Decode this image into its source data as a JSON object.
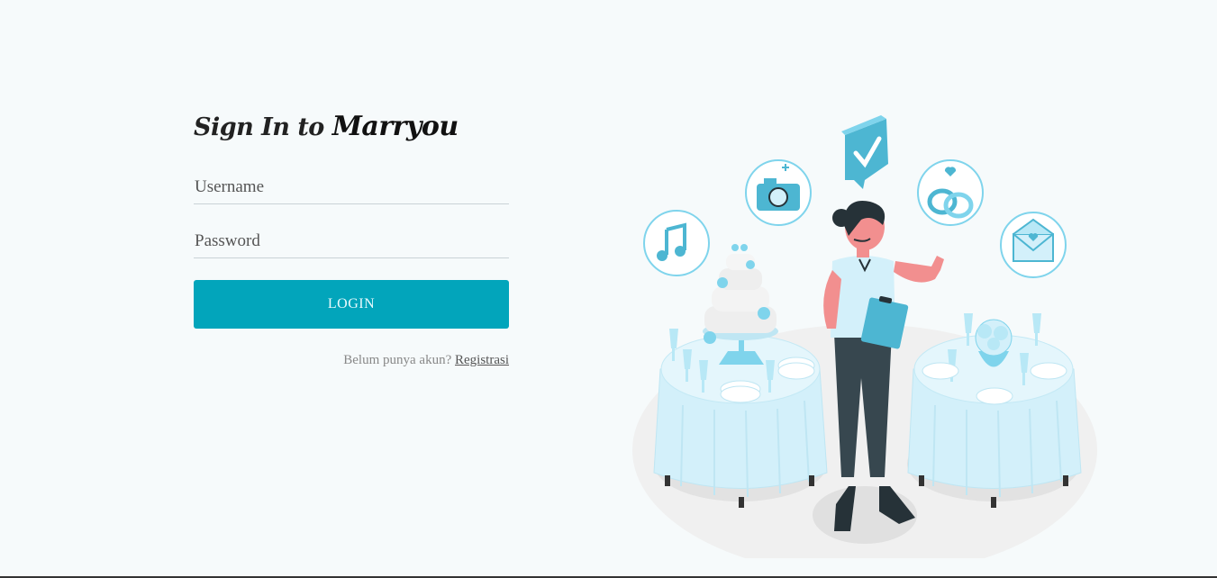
{
  "title": {
    "prefix": "Sign In to",
    "brand": "Marryou"
  },
  "form": {
    "username_placeholder": "Username",
    "password_placeholder": "Password",
    "login_label": "LOGIN",
    "register_prompt": "Belum punya akun?",
    "register_link": "Registrasi"
  },
  "colors": {
    "accent": "#02a5bb",
    "background": "#f6fafb",
    "illustration_light": "#d3f0fa",
    "illustration_mid": "#7fd4ec",
    "illustration_dark": "#263238"
  },
  "illustration": {
    "subject": "wedding-planner-illustration",
    "icons": [
      "music-icon",
      "camera-icon",
      "checkmark-icon",
      "rings-icon",
      "envelope-icon"
    ]
  }
}
